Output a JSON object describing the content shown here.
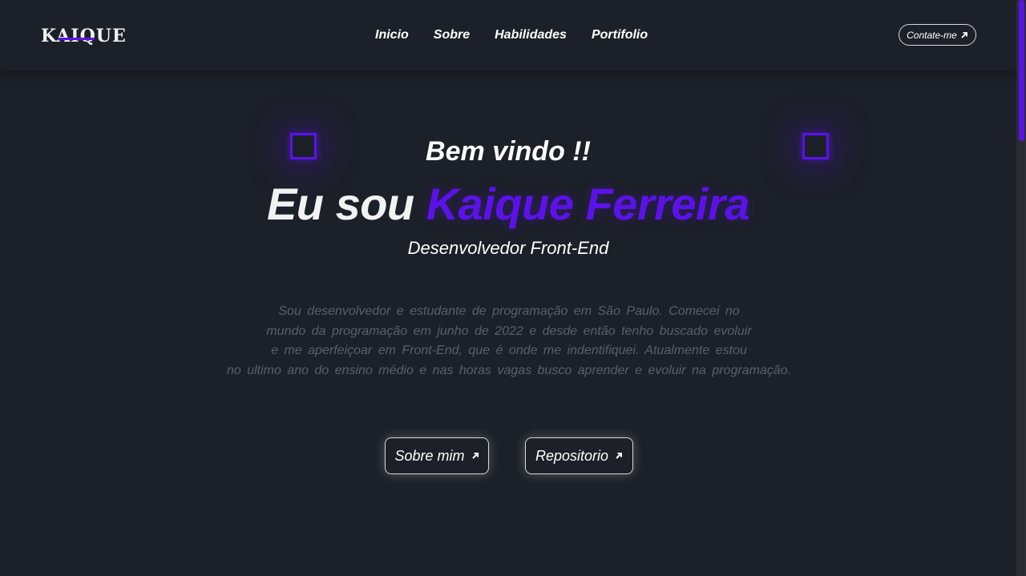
{
  "header": {
    "logo": "KAIQUE",
    "nav": [
      "Inicio",
      "Sobre",
      "Habilidades",
      "Portifolio"
    ],
    "contact_label": "Contate-me"
  },
  "hero": {
    "welcome": "Bem vindo !!",
    "headline_prefix": "Eu sou",
    "headline_name": "Kaique Ferreira",
    "role": "Desenvolvedor Front-End",
    "bio_lines": [
      "Sou desenvolvedor e estudante de programação em São Paulo. Comecei no",
      "mundo da programação em junho de 2022 e desde então tenho buscado evoluir",
      "e me aperfeiçoar em Front-End, que é onde me indentifiquei. Atualmente estou",
      "no ultimo ano do ensino médio e nas horas vagas busco aprender e evoluir na programação."
    ],
    "buttons": {
      "about": "Sobre mim",
      "repo": "Repositorio"
    }
  },
  "icons": {
    "external": "arrow-up-right-icon",
    "decor": "square-outline-icon"
  },
  "colors": {
    "background": "#1c2028",
    "accent": "#5b12e8",
    "muted_text": "#5b5f67"
  }
}
